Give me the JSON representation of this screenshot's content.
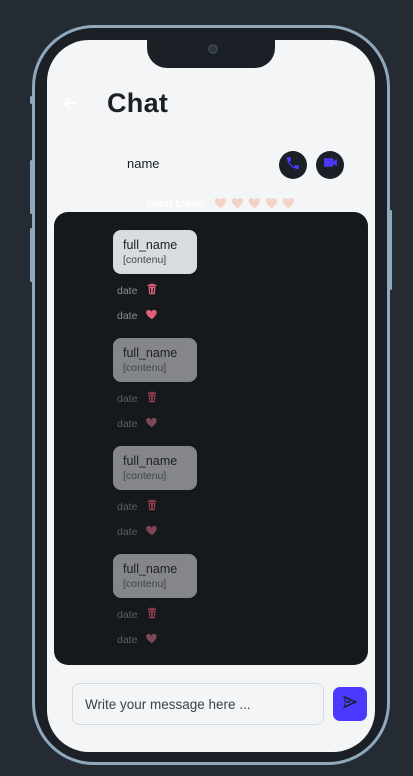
{
  "header": {
    "title": "Chat"
  },
  "contact": {
    "name": "name"
  },
  "likes": {
    "label": "Most Likes",
    "count": 5
  },
  "messages": [
    {
      "full_name": "full_name",
      "content": "[contenu]",
      "date": "date",
      "bubble_color": "#d9dcdf",
      "faded": false
    },
    {
      "full_name": "full_name",
      "content": "[contenu]",
      "date": "date",
      "bubble_color": "#84868a",
      "faded": true
    },
    {
      "full_name": "full_name",
      "content": "[contenu]",
      "date": "date",
      "bubble_color": "#84868a",
      "faded": true
    },
    {
      "full_name": "full_name",
      "content": "[contenu]",
      "date": "date",
      "bubble_color": "#84868a",
      "faded": true
    }
  ],
  "composer": {
    "placeholder": "Write your message here ..."
  },
  "colors": {
    "accent": "#4a3aff",
    "heart": "#e0607e",
    "heart_faded": "#7c4652",
    "likes_heart": "#f2d3c7",
    "trash": "#e0607e",
    "trash_faded": "#8c3f4c"
  },
  "icons": {
    "back": "arrow-left-icon",
    "call": "phone-icon",
    "video": "video-camera-icon",
    "delete": "trash-icon",
    "like": "heart-icon",
    "send": "send-icon"
  }
}
